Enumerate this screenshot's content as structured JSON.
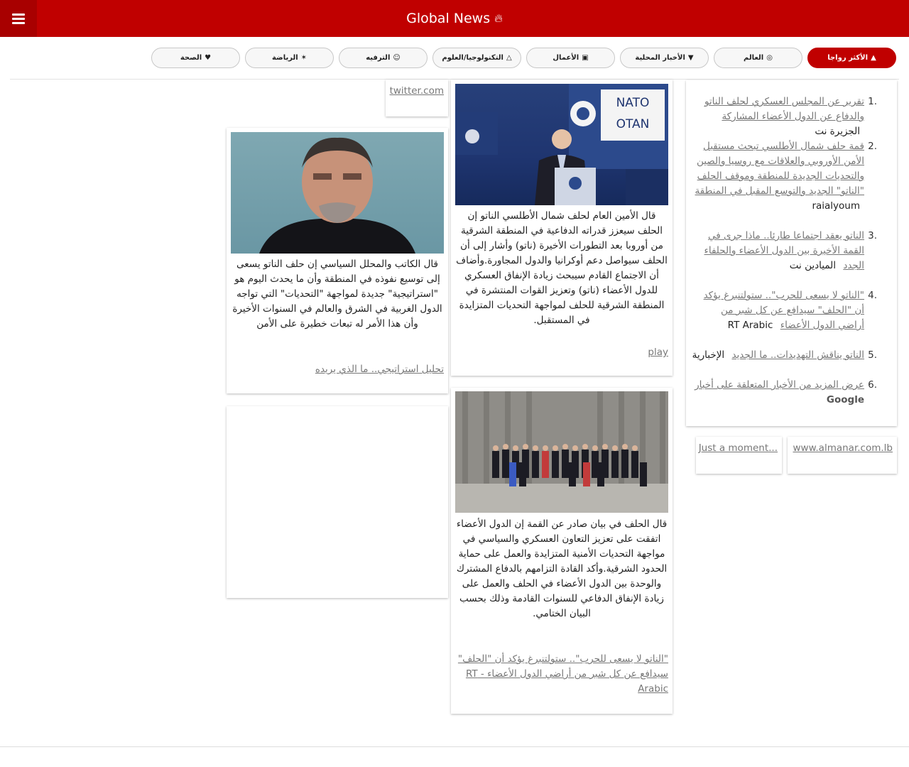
{
  "header": {
    "title": "Global News",
    "title_icon": "fire-icon",
    "colors": {
      "bar": "#c00000",
      "menu_button": "#a80000"
    }
  },
  "tabs": [
    {
      "label": "الأكثر رواجا",
      "icon": "fire-icon",
      "active": true
    },
    {
      "label": "العالم",
      "icon": "globe-icon",
      "active": false
    },
    {
      "label": "الأخبار المحلية",
      "icon": "map-pin-icon",
      "active": false
    },
    {
      "label": "الأعمال",
      "icon": "briefcase-icon",
      "active": false
    },
    {
      "label": "التكنولوجيا/العلوم",
      "icon": "flask-icon",
      "active": false
    },
    {
      "label": "الترفيه",
      "icon": "theater-masks-icon",
      "active": false
    },
    {
      "label": "الرياضة",
      "icon": "running-icon",
      "active": false
    },
    {
      "label": "الصحة",
      "icon": "heartbeat-icon",
      "active": false
    }
  ],
  "trending": [
    {
      "num": "1.",
      "title": "تقرير عن المجلس العسكري لحلف الناتو والدفاع عن الدول الأعضاء المشاركة",
      "source": "الجزيرة نت",
      "gl": ""
    },
    {
      "num": "2.",
      "title": "قمة حلف شمال الأطلسي تبحث مستقبل الأمن الأوروبي والعلاقات مع روسيا والصين والتحديات الجديدة للمنطقة وموقف الحلف \"الناتو\" الجديد والتوسع المقبل في المنطقة",
      "source": "raialyoum",
      "gl": ""
    },
    {
      "num": "3.",
      "title": "الناتو يعقد اجتماعا طارئا.. ماذا جرى في القمة الأخيرة بين الدول الأعضاء والحلفاء الجدد",
      "source": "الميادين نت",
      "gl": ""
    },
    {
      "num": "4.",
      "title": "\"الناتو لا يسعى للحرب\".. ستولتنبرغ يؤكد أن \"الحلف\" سيدافع عن كل شبر من أراضي الدول الأعضاء",
      "source": "RT Arabic",
      "gl": ""
    },
    {
      "num": "5.",
      "title": "الناتو يناقش التهديدات.. ما الجديد",
      "source": "الإخبارية",
      "gl": ""
    },
    {
      "num": "6.",
      "title": "عرض المزيد من الأخبار المتعلقة على أخبار",
      "source": "",
      "gl": "Google"
    }
  ],
  "side_links": [
    {
      "label": "www.almanar.com.lb"
    },
    {
      "label": "Just a moment..."
    }
  ],
  "articles": [
    {
      "image": "nato-press-conference",
      "body": "قال الأمين العام لحلف شمال الأطلسي الناتو إن الحلف سيعزز قدراته الدفاعية في المنطقة الشرقية من أوروبا بعد التطورات الأخيرة (ناتو) وأشار إلى أن الحلف سيواصل دعم أوكرانيا والدول المجاورة.وأضاف أن الاجتماع القادم سيبحث زيادة الإنفاق العسكري للدول الأعضاء (ناتو) وتعزيز القوات المنتشرة في المنطقة الشرقية للحلف لمواجهة التحديات المتزايدة في المستقبل.",
      "link": "play"
    },
    {
      "image": "nato-family-photo",
      "body": "قال الحلف في بيان صادر عن القمة إن الدول الأعضاء اتفقت على تعزيز التعاون العسكري والسياسي في مواجهة التحديات الأمنية المتزايدة والعمل على حماية الحدود الشرقية.وأكد القادة التزامهم بالدفاع المشترك والوحدة بين الدول الأعضاء في الحلف والعمل على زيادة الإنفاق الدفاعي للسنوات القادمة وذلك بحسب البيان الختامي.",
      "link": "\"الناتو لا يسعى للحرب\".. ستولتنبرغ يؤكد أن \"الحلف\" سيدافع عن كل شبر من أراضي الدول الأعضاء - RT Arabic"
    },
    {
      "image": "man-portrait",
      "body": "قال الكاتب والمحلل السياسي إن حلف الناتو يسعى إلى توسيع نفوذه في المنطقة وأن ما يحدث اليوم هو \"استراتيجية\" جديدة لمواجهة \"التحديات\" التي تواجه الدول الغربية في الشرق والعالم في السنوات الأخيرة وأن هذا الأمر له تبعات خطيرة على الأمن",
      "link": "تحليل استراتيجي.. ما الذي يريده"
    }
  ],
  "twitter_link": "twitter.com"
}
